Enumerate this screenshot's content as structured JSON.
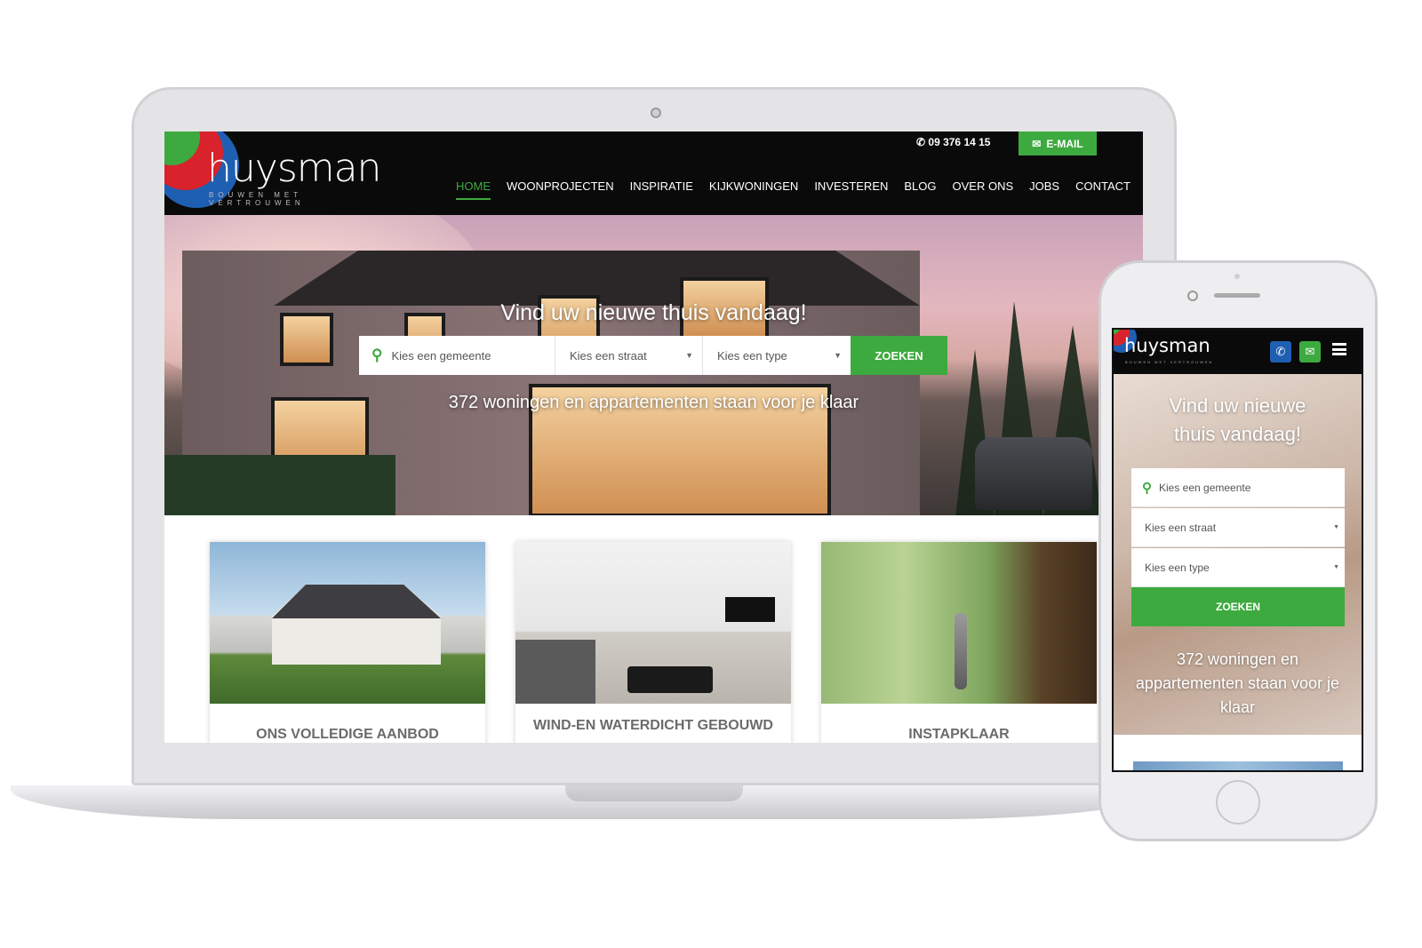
{
  "brand": {
    "name": "huysman",
    "tagline": "BOUWEN MET VERTROUWEN",
    "green": "#3daa3f",
    "red": "#d8222c",
    "blue": "#1f5fb2"
  },
  "topbar": {
    "phone_icon": "phone-icon",
    "phone": "09 376 14 15",
    "email_icon": "envelope-icon",
    "email_label": "E-MAIL"
  },
  "nav": {
    "items": [
      "HOME",
      "WOONPROJECTEN",
      "INSPIRATIE",
      "KIJKWONINGEN",
      "INVESTEREN",
      "BLOG",
      "OVER ONS",
      "JOBS",
      "CONTACT"
    ],
    "active": "HOME"
  },
  "hero": {
    "title": "Vind uw nieuwe thuis vandaag!",
    "search_placeholder": "Kies een gemeente",
    "street_placeholder": "Kies een straat",
    "type_placeholder": "Kies een type",
    "search_button": "ZOEKEN",
    "subtitle": "372 woningen en appartementen staan voor je klaar"
  },
  "cards": [
    {
      "title": "ONS VOLLEDIGE AANBOD"
    },
    {
      "title": "WIND-EN WATERDICHT GEBOUWD"
    },
    {
      "title": "INSTAPKLAAR"
    }
  ],
  "mobile": {
    "title_line1": "Vind uw nieuwe",
    "title_line2": "thuis vandaag!",
    "search_placeholder": "Kies een gemeente",
    "street_placeholder": "Kies een straat",
    "type_placeholder": "Kies een type",
    "search_button": "ZOEKEN",
    "sub_line1": "372 woningen en",
    "sub_line2": "appartementen staan voor je",
    "sub_line3": "klaar"
  }
}
